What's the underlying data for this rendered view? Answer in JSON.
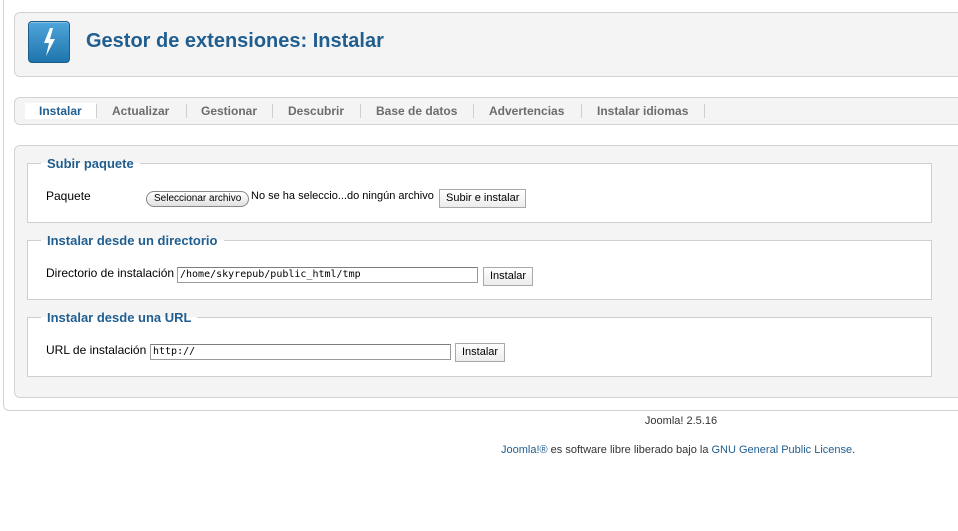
{
  "header": {
    "title": "Gestor de extensiones: Instalar",
    "logo_icon": "lightning-bolt-icon"
  },
  "tabs": [
    {
      "label": "Instalar",
      "active": true
    },
    {
      "label": "Actualizar",
      "active": false
    },
    {
      "label": "Gestionar",
      "active": false
    },
    {
      "label": "Descubrir",
      "active": false
    },
    {
      "label": "Base de datos",
      "active": false
    },
    {
      "label": "Advertencias",
      "active": false
    },
    {
      "label": "Instalar idiomas",
      "active": false
    }
  ],
  "upload": {
    "legend": "Subir paquete",
    "label": "Paquete",
    "choose_file_label": "Seleccionar archivo",
    "file_status": "No se ha seleccio...do ningún archivo",
    "submit_label": "Subir e instalar"
  },
  "directory": {
    "legend": "Instalar desde un directorio",
    "label": "Directorio de instalación",
    "value": "/home/skyrepub/public_html/tmp",
    "submit_label": "Instalar"
  },
  "url": {
    "legend": "Instalar desde una URL",
    "label": "URL de instalación",
    "value": "http://",
    "submit_label": "Instalar"
  },
  "footer": {
    "version": "Joomla! 2.5.16",
    "joomla_link": "Joomla!®",
    "license_text": " es software libre liberado bajo la ",
    "license_link": "GNU General Public License",
    "period": "."
  },
  "colors": {
    "accent": "#205e90",
    "panel_bg": "#f4f4f4",
    "border": "#d2d2d2"
  }
}
